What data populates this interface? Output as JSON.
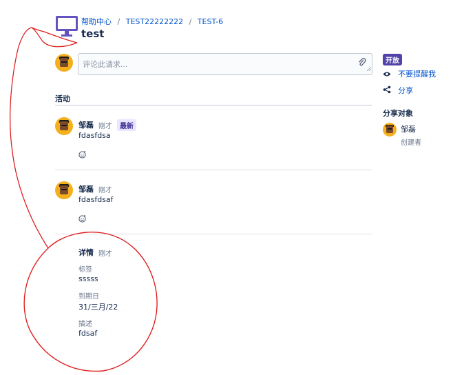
{
  "breadcrumb": {
    "items": [
      "帮助中心",
      "TEST22222222",
      "TEST-6"
    ],
    "separator": "/"
  },
  "issue": {
    "title": "test"
  },
  "comment_box": {
    "placeholder": "评论此请求..."
  },
  "activity": {
    "heading": "活动",
    "entries": [
      {
        "author": "邹磊",
        "time": "刚才",
        "badge": "最新",
        "text": "fdasfdsa"
      },
      {
        "author": "邹磊",
        "time": "刚才",
        "text": "fdasfdsaf"
      }
    ],
    "details": {
      "title": "详情",
      "time": "刚才",
      "fields": [
        {
          "label": "标签",
          "value": "sssss"
        },
        {
          "label": "到期日",
          "value": "31/三月/22"
        },
        {
          "label": "描述",
          "value": "fdsaf"
        }
      ]
    }
  },
  "sidebar": {
    "status": "开放",
    "notify_label": "不要提醒我",
    "share_label": "分享",
    "shared_with_heading": "分享对象",
    "shared_user": {
      "name": "邹磊",
      "role": "创建者"
    }
  },
  "colors": {
    "accent": "#0052cc",
    "status_purple": "#5243aa",
    "badge_bg": "#eae6ff",
    "annotation_red": "#e02020"
  }
}
